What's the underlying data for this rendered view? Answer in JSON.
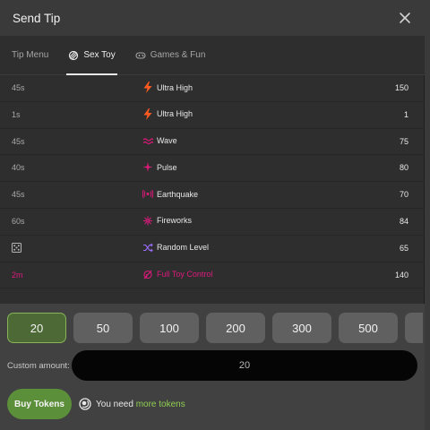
{
  "dialog": {
    "title": "Send Tip"
  },
  "tabs": [
    {
      "label": "Tip Menu",
      "icon": "none"
    },
    {
      "label": "Sex Toy",
      "icon": "toy-icon"
    },
    {
      "label": "Games & Fun",
      "icon": "gamepad-icon"
    }
  ],
  "rows": [
    {
      "duration": "45s",
      "name": "Ultra High",
      "icon": "lightning-icon",
      "value": "150"
    },
    {
      "duration": "1s",
      "name": "Ultra High",
      "icon": "lightning-icon",
      "value": "1"
    },
    {
      "duration": "45s",
      "name": "Wave",
      "icon": "wave-icon",
      "value": "75"
    },
    {
      "duration": "40s",
      "name": "Pulse",
      "icon": "pulse-icon",
      "value": "80"
    },
    {
      "duration": "45s",
      "name": "Earthquake",
      "icon": "earthquake-icon",
      "value": "70"
    },
    {
      "duration": "60s",
      "name": "Fireworks",
      "icon": "fireworks-icon",
      "value": "84"
    },
    {
      "duration": "",
      "name": "Random Level",
      "icon": "shuffle-icon",
      "value": "65"
    },
    {
      "duration": "2m",
      "name": "Full Toy Control",
      "icon": "toy-control-icon",
      "value": "140"
    }
  ],
  "amounts": [
    "20",
    "50",
    "100",
    "200",
    "300",
    "500"
  ],
  "selected_amount": "20",
  "custom": {
    "label": "Custom amount:",
    "value": "20"
  },
  "buy": {
    "label": "Buy Tokens"
  },
  "need": {
    "prefix": "You need ",
    "link": "more tokens"
  },
  "colors": {
    "accent_green": "#5c8f3a",
    "link_green": "#8fcf52",
    "toy_pink": "#e0197d",
    "lightning_orange": "#ff5a1f"
  }
}
